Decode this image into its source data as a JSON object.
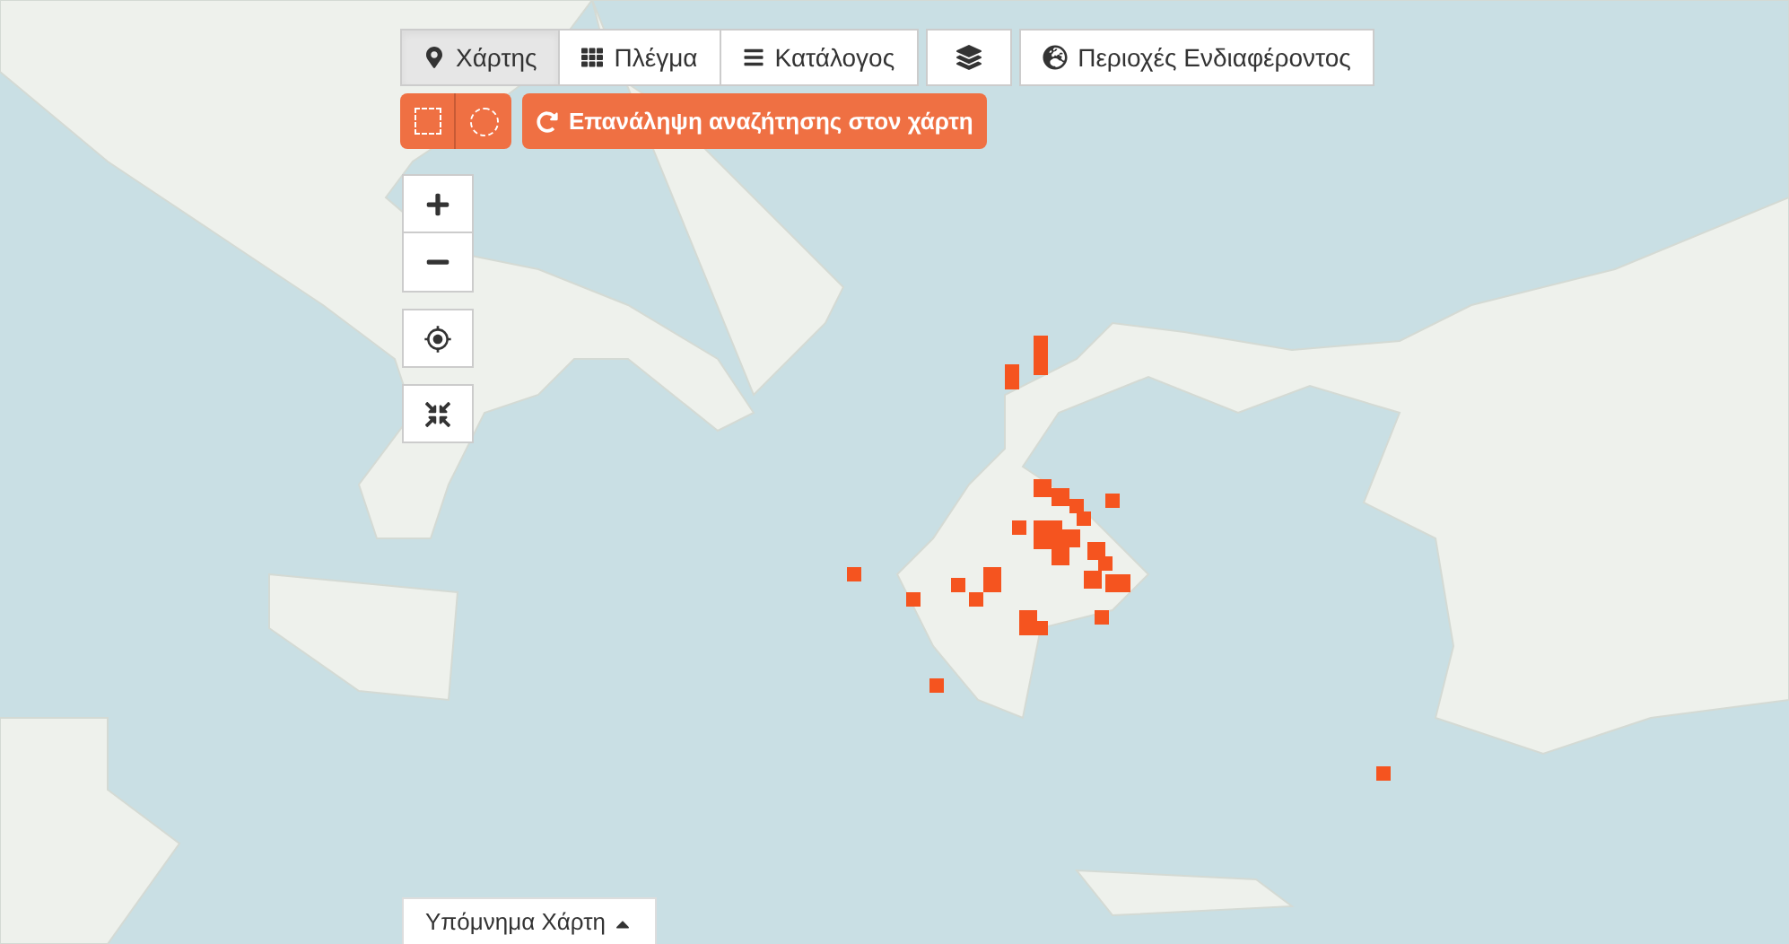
{
  "view_tabs": [
    {
      "kind": "map",
      "label": "Χάρτης",
      "selected": true
    },
    {
      "kind": "grid",
      "label": "Πλέγμα",
      "selected": false
    },
    {
      "kind": "list",
      "label": "Κατάλογος",
      "selected": false
    }
  ],
  "areas_button": {
    "label": "Περιοχές Ενδιαφέροντος"
  },
  "search_button": {
    "label": "Επανάληψη αναζήτησης στον χάρτη"
  },
  "legend": {
    "label": "Υπόμνημα Χάρτη",
    "expanded": false
  }
}
